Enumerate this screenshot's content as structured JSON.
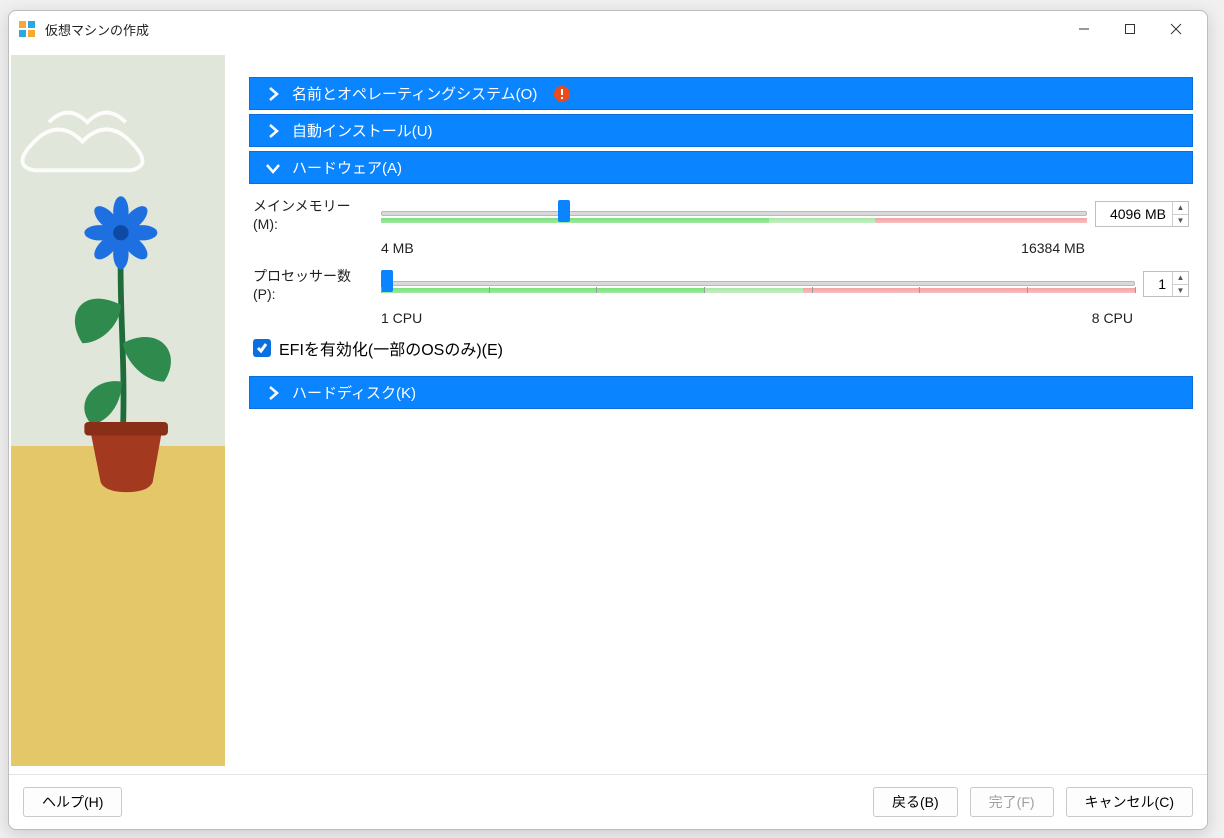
{
  "window": {
    "title": "仮想マシンの作成"
  },
  "sections": {
    "name_os": {
      "label": "名前とオペレーティングシステム(O)"
    },
    "unattended": {
      "label": "自動インストール(U)"
    },
    "hardware": {
      "label": "ハードウェア(A)"
    },
    "harddisk": {
      "label": "ハードディスク(K)"
    }
  },
  "hardware": {
    "memory_label": "メインメモリー(M):",
    "memory_value": "4096 MB",
    "memory_min": "4 MB",
    "memory_max": "16384 MB",
    "cpu_label": "プロセッサー数(P):",
    "cpu_value": "1",
    "cpu_min": "1 CPU",
    "cpu_max": "8 CPU",
    "efi_label": "EFIを有効化(一部のOSのみ)(E)"
  },
  "footer": {
    "help": "ヘルプ(H)",
    "back": "戻る(B)",
    "finish": "完了(F)",
    "cancel": "キャンセル(C)"
  }
}
